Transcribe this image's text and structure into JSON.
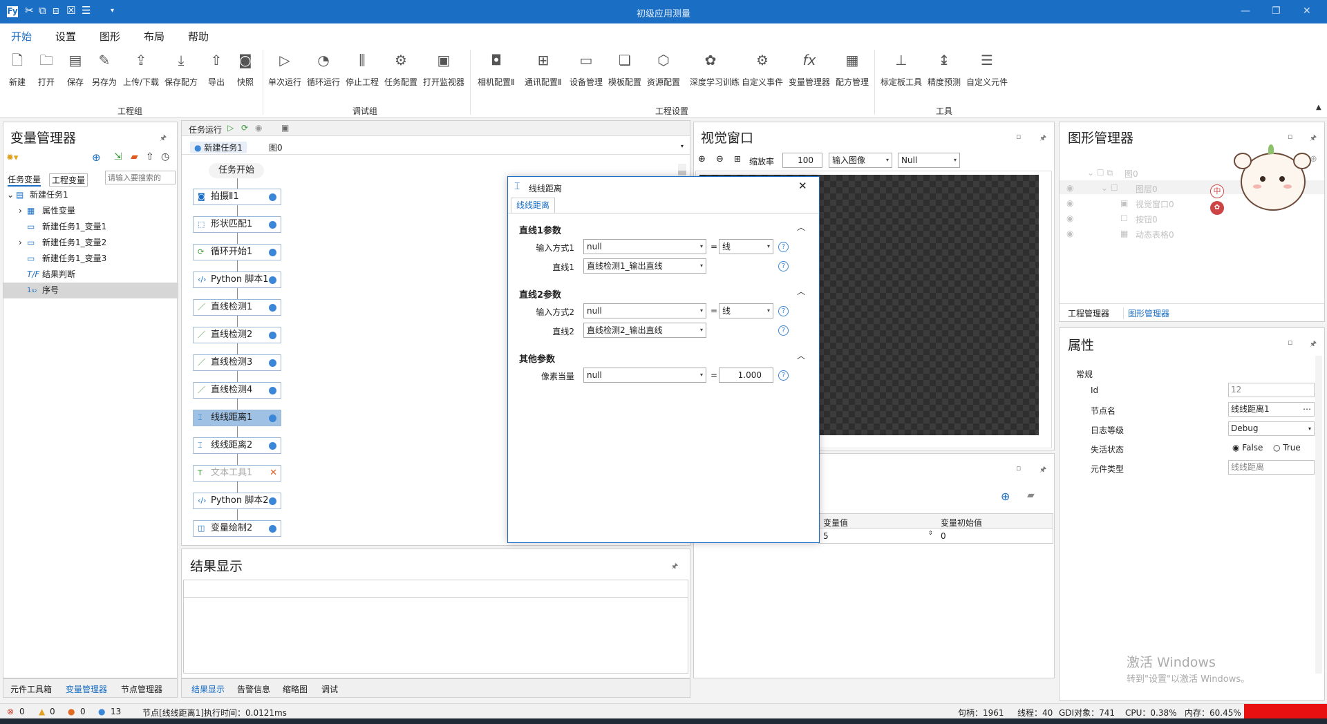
{
  "app": {
    "title": "初级应用测量"
  },
  "menu": [
    "开始",
    "设置",
    "图形",
    "布局",
    "帮助"
  ],
  "ribbon": {
    "buttons": [
      "新建",
      "打开",
      "保存",
      "另存为",
      "上传/下载",
      "保存配方",
      "导出",
      "快照",
      "单次运行",
      "循环运行",
      "停止工程",
      "任务配置",
      "打开监视器",
      "相机配置Ⅱ",
      "通讯配置Ⅱ",
      "设备管理",
      "模板配置",
      "资源配置",
      "深度学习训练",
      "自定义事件",
      "变量管理器",
      "配方管理",
      "标定板工具",
      "精度预测",
      "自定义元件"
    ],
    "groups": [
      "工程组",
      "调试组",
      "工程设置",
      "工具"
    ]
  },
  "var_manager": {
    "title": "变量管理器",
    "tabs": [
      "任务变量",
      "工程变量"
    ],
    "search_placeholder": "请输入要搜索的",
    "tree": [
      "新建任务1",
      "属性变量",
      "新建任务1_变量1",
      "新建任务1_变量2",
      "新建任务1_变量3",
      "结果判断",
      "序号"
    ]
  },
  "task": {
    "run_label": "任务运行",
    "tabs": [
      "新建任务1",
      "图0"
    ],
    "start": "任务开始",
    "nodes": [
      "拍摄Ⅱ1",
      "形状匹配1",
      "循环开始1",
      "Python 脚本1",
      "直线检测1",
      "直线检测2",
      "直线检测3",
      "直线检测4",
      "线线距离1",
      "线线距离2",
      "文本工具1",
      "Python 脚本2",
      "变量绘制2"
    ]
  },
  "result": {
    "title": "结果显示"
  },
  "vision": {
    "title": "视觉窗口",
    "zoom_label": "缩放率",
    "zoom_value": "100",
    "input_image": "输入图像",
    "null_option": "Null"
  },
  "dialog": {
    "title": "线线距离",
    "tab": "线线距离",
    "section1": "直线1参数",
    "section2": "直线2参数",
    "section3": "其他参数",
    "input_mode_label": "输入方式1",
    "input_mode_value": "null",
    "mode_value": "线",
    "line1_label": "直线1",
    "line1_value": "直线检测1_输出直线",
    "input_mode2_label": "输入方式2",
    "line2_label": "直线2",
    "line2_value": "直线检测2_输出直线",
    "pixel_label": "像素当量",
    "pixel_value": "1.000",
    "eq": "="
  },
  "var_table": {
    "headers": [
      "变量值",
      "变量初始值"
    ],
    "row": [
      "5",
      "0"
    ]
  },
  "graph_manager": {
    "title": "图形管理器",
    "tree": [
      "图0",
      "图层0",
      "视觉窗口0",
      "按钮0",
      "动态表格0"
    ],
    "tabs": [
      "工程管理器",
      "图形管理器"
    ]
  },
  "properties": {
    "title": "属性",
    "section": "常规",
    "rows": [
      {
        "label": "Id",
        "value": "12"
      },
      {
        "label": "节点名",
        "value": "线线距离1"
      },
      {
        "label": "日志等级",
        "value": "Debug"
      },
      {
        "label": "失活状态",
        "value": ""
      },
      {
        "label": "元件类型",
        "value": "线线距离"
      }
    ],
    "radio_false": "False",
    "radio_true": "True"
  },
  "bottom_tabs_left": [
    "元件工具箱",
    "变量管理器",
    "节点管理器"
  ],
  "bottom_tabs_mid": [
    "结果显示",
    "告警信息",
    "缩略图",
    "调试"
  ],
  "status": {
    "err": "0",
    "warn": "0",
    "c2": "0",
    "c3": "13",
    "message": "节点[线线距离1]执行时间：0.0121ms",
    "handles": "句柄：1961",
    "threads": "线程：40",
    "gdi": "GDI对象：741",
    "cpu": "CPU：0.38%",
    "mem": "内存：60.45%"
  },
  "watermark": {
    "line1": "激活 Windows",
    "line2": "转到\"设置\"以激活 Windows。"
  },
  "colors": {
    "accent": "#1a6fc4",
    "node_dot": "#3b86d6",
    "selected_node": "#9fc1e4"
  }
}
